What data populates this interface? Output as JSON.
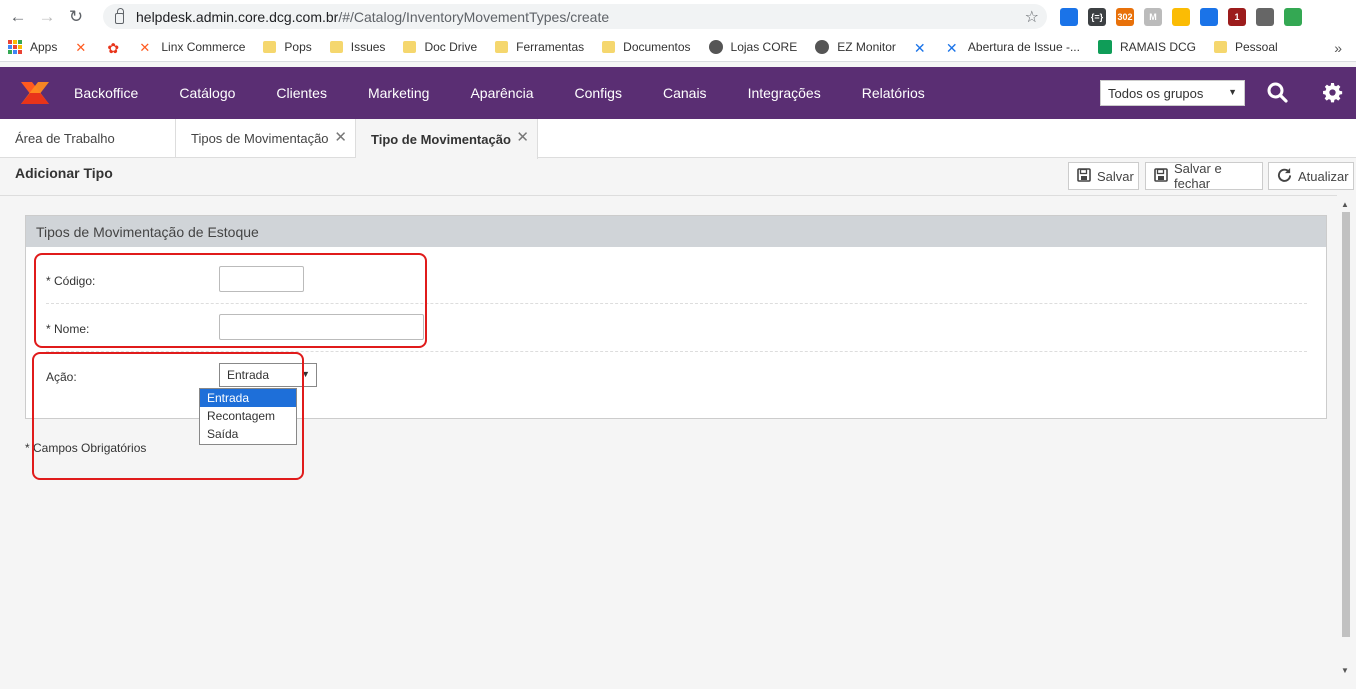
{
  "browser": {
    "url_host": "helpdesk.admin.core.dcg.com.br",
    "url_path": "/#/Catalog/InventoryMovementTypes/create",
    "extensions": [
      {
        "name": "ext-1",
        "label": "",
        "color": "#1a73e8"
      },
      {
        "name": "ext-json",
        "label": "{=}",
        "color": "#3c4043"
      },
      {
        "name": "ext-302",
        "label": "302",
        "color": "#e8710a"
      },
      {
        "name": "ext-m",
        "label": "M",
        "color": "#bbbbbb"
      },
      {
        "name": "ext-circle",
        "label": "",
        "color": "#fbbc04"
      },
      {
        "name": "ext-r",
        "label": "",
        "color": "#1a73e8"
      },
      {
        "name": "ext-u",
        "label": "1",
        "color": "#9c1c1c"
      },
      {
        "name": "ext-profile",
        "label": "",
        "color": "#666666"
      },
      {
        "name": "ext-green",
        "label": "",
        "color": "#34a853"
      }
    ]
  },
  "bookmarks": {
    "apps_label": "Apps",
    "items": [
      {
        "label": "",
        "icon": "linx-x-icon"
      },
      {
        "label": "",
        "icon": "flower-icon"
      },
      {
        "label": "Linx Commerce",
        "icon": "linx-x-icon"
      },
      {
        "label": "Pops",
        "icon": "folder-icon"
      },
      {
        "label": "Issues",
        "icon": "folder-icon"
      },
      {
        "label": "Doc Drive",
        "icon": "folder-icon"
      },
      {
        "label": "Ferramentas",
        "icon": "folder-icon"
      },
      {
        "label": "Documentos",
        "icon": "folder-icon"
      },
      {
        "label": "Lojas CORE",
        "icon": "globe-icon"
      },
      {
        "label": "EZ Monitor",
        "icon": "globe-icon"
      },
      {
        "label": "",
        "icon": "confluence-icon"
      },
      {
        "label": "Abertura de Issue -...",
        "icon": "confluence-icon"
      },
      {
        "label": "RAMAIS DCG",
        "icon": "sheets-icon"
      },
      {
        "label": "Pessoal",
        "icon": "folder-icon"
      }
    ],
    "more": "»"
  },
  "appbar": {
    "menu": [
      "Backoffice",
      "Catálogo",
      "Clientes",
      "Marketing",
      "Aparência",
      "Configs",
      "Canais",
      "Integrações",
      "Relatórios"
    ],
    "group_select": "Todos os grupos",
    "brand_color": "#5a2e73"
  },
  "tabs": [
    {
      "label": "Área de Trabalho",
      "closable": false
    },
    {
      "label": "Tipos de Movimentação d",
      "closable": true
    },
    {
      "label": "Tipo de Movimentação d",
      "closable": true,
      "active": true
    }
  ],
  "page": {
    "title": "Adicionar Tipo",
    "buttons": {
      "save": "Salvar",
      "save_close": "Salvar e fechar",
      "refresh": "Atualizar"
    }
  },
  "form": {
    "panel_title": "Tipos de Movimentação de Estoque",
    "codigo_label": "* Código:",
    "codigo_value": "",
    "nome_label": "* Nome:",
    "nome_value": "",
    "acao_label": "Ação:",
    "acao_value": "Entrada",
    "acao_options": [
      "Entrada",
      "Recontagem",
      "Saída"
    ],
    "required_note": "* Campos Obrigatórios"
  },
  "highlight_color": "#e01b1b"
}
